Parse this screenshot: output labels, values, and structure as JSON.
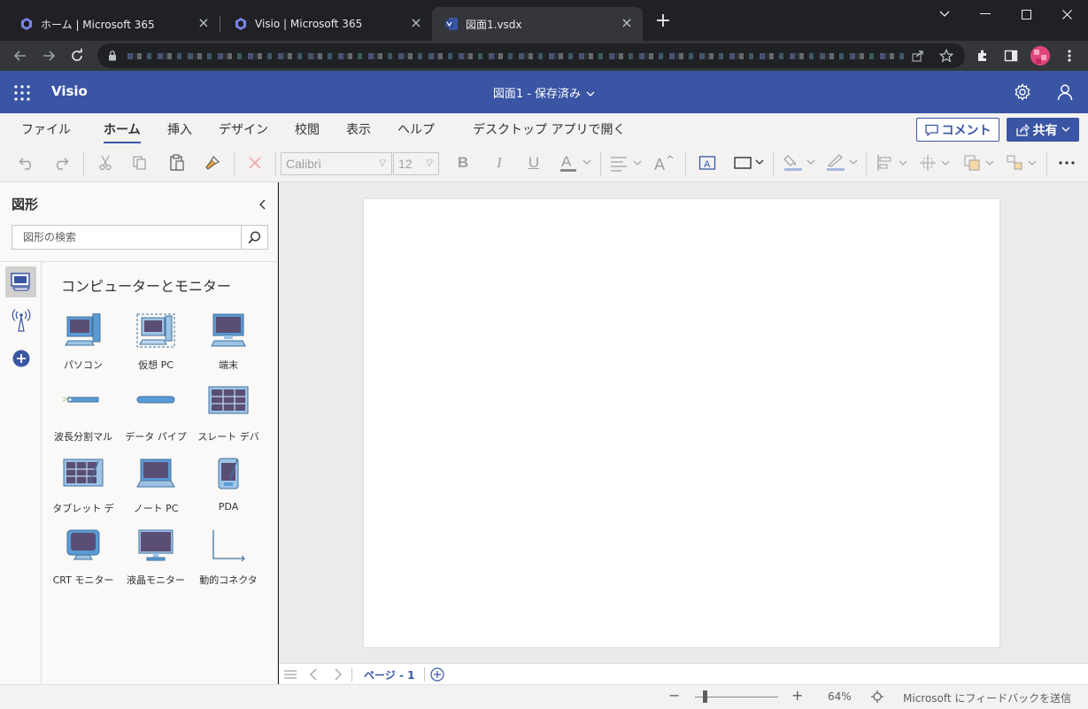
{
  "browser": {
    "tabs": [
      {
        "title": "ホーム | Microsoft 365"
      },
      {
        "title": "Visio | Microsoft 365"
      },
      {
        "title": "図面1.vsdx"
      }
    ]
  },
  "app": {
    "name": "Visio",
    "doc_title": "図面1 - 保存済み"
  },
  "ribbon": {
    "tabs": [
      "ファイル",
      "ホーム",
      "挿入",
      "デザイン",
      "校閲",
      "表示",
      "ヘルプ",
      "デスクトップ アプリで開く"
    ],
    "active_tab": "ホーム",
    "comment_label": "コメント",
    "share_label": "共有"
  },
  "toolbar": {
    "font_name": "Calibri",
    "font_size": "12"
  },
  "shapes_panel": {
    "title": "図形",
    "search_placeholder": "図形の検索",
    "stencil_title": "コンピューターとモニター",
    "shapes": [
      {
        "label": "パソコン",
        "icon": "pc-icon"
      },
      {
        "label": "仮想 PC",
        "icon": "virtual-pc-icon"
      },
      {
        "label": "端末",
        "icon": "terminal-icon"
      },
      {
        "label": "波長分割マル",
        "icon": "wdm-icon"
      },
      {
        "label": "データ パイプ",
        "icon": "data-pipe-icon"
      },
      {
        "label": "スレート デバ",
        "icon": "slate-device-icon"
      },
      {
        "label": "タブレット デ",
        "icon": "tablet-device-icon"
      },
      {
        "label": "ノート PC",
        "icon": "laptop-icon"
      },
      {
        "label": "PDA",
        "icon": "pda-icon"
      },
      {
        "label": "CRT モニター",
        "icon": "crt-monitor-icon"
      },
      {
        "label": "液晶モニター",
        "icon": "lcd-monitor-icon"
      },
      {
        "label": "動的コネクタ",
        "icon": "dynamic-connector-icon"
      }
    ]
  },
  "pages": {
    "current": "ページ - 1"
  },
  "status": {
    "zoom": "64%",
    "feedback": "Microsoft にフィードバックを送信"
  },
  "colors": {
    "accent": "#3a55a4",
    "chrome_dark": "#202124",
    "chrome_tab": "#35363a"
  }
}
